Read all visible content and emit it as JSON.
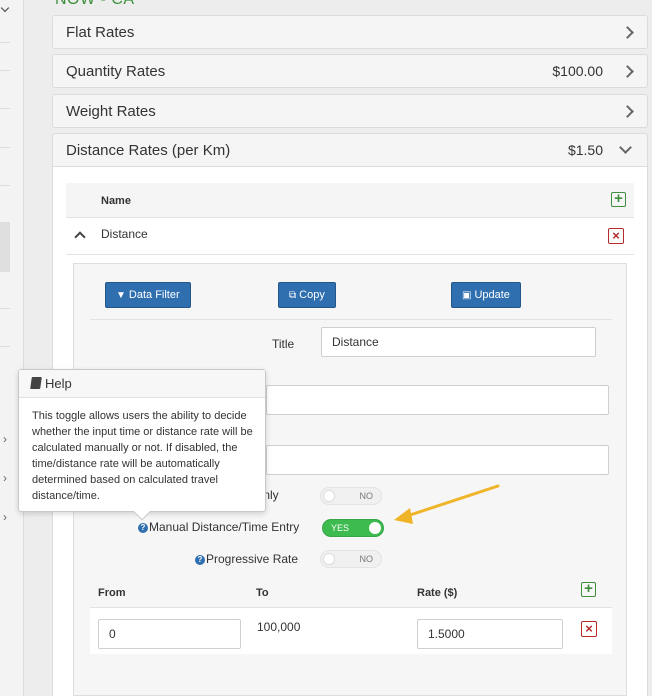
{
  "heading_partial": "NOW - CA",
  "panels": [
    {
      "title": "Flat Rates",
      "value": ""
    },
    {
      "title": "Quantity Rates",
      "value": "$100.00"
    },
    {
      "title": "Weight Rates",
      "value": ""
    },
    {
      "title": "Distance Rates (per Km)",
      "value": "$1.50"
    }
  ],
  "table": {
    "name_header": "Name",
    "rows": [
      {
        "name": "Distance"
      }
    ]
  },
  "detail": {
    "buttons": {
      "data_filter": "Data Filter",
      "copy": "Copy",
      "update": "Update"
    },
    "title_label": "Title",
    "title_value": "Distance",
    "toggles": [
      {
        "label": "Only",
        "state": "NO"
      },
      {
        "label": "Manual Distance/Time Entry",
        "state": "YES"
      },
      {
        "label": "Progressive Rate",
        "state": "NO"
      }
    ],
    "rates": {
      "headers": {
        "from": "From",
        "to": "To",
        "rate": "Rate ($)"
      },
      "rows": [
        {
          "from": "0",
          "to": "100,000",
          "rate": "1.5000"
        }
      ]
    }
  },
  "help_popover": {
    "title": "Help",
    "body": "This toggle allows users the ability to decide whether the input time or distance rate will be calculated manually or not. If disabled, the time/distance rate will be automatically determined based on calculated travel distance/time."
  },
  "icons": {
    "chevron": "chevron-right-icon",
    "add": "plus-square-icon",
    "delete": "times-square-icon",
    "filter": "filter-icon",
    "copy": "copy-icon",
    "update": "save-icon",
    "help": "question-circle-icon",
    "book": "book-icon"
  },
  "colors": {
    "primary_button": "#2f6fb0",
    "toggle_on": "#3dbb4e",
    "add_green": "#3f8f3f",
    "delete_red": "#b52a2a",
    "annotation_arrow": "#f0b429",
    "heading_green": "#3a8f3a"
  }
}
